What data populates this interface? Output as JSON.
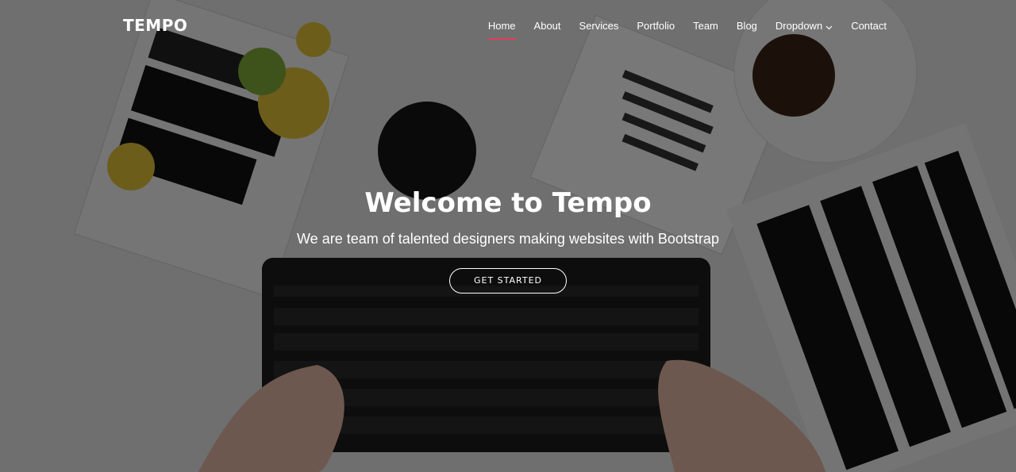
{
  "brand": {
    "name": "TEMPO"
  },
  "nav": {
    "items": [
      {
        "label": "Home",
        "active": true
      },
      {
        "label": "About"
      },
      {
        "label": "Services"
      },
      {
        "label": "Portfolio"
      },
      {
        "label": "Team"
      },
      {
        "label": "Blog"
      },
      {
        "label": "Dropdown",
        "icon": "chevron-down-icon"
      },
      {
        "label": "Contact"
      }
    ]
  },
  "hero": {
    "title": "Welcome to Tempo",
    "subtitle": "We are team of talented designers making websites with Bootstrap",
    "cta_label": "GET STARTED"
  },
  "colors": {
    "accent": "#e43c5c",
    "overlay": "rgba(0,0,0,0.52)",
    "text": "#ffffff"
  }
}
